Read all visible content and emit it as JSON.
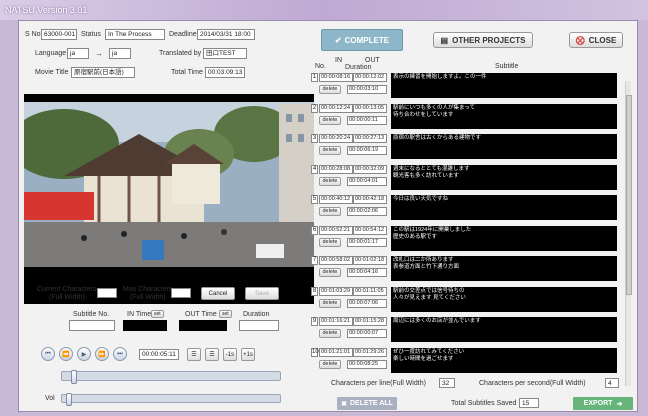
{
  "app": {
    "title": "NATSU Version 3.01"
  },
  "header": {
    "sno_label": "S No.",
    "sno_value": "63000-001",
    "status_label": "Status",
    "status_value": "In The Process",
    "deadline_label": "Deadline",
    "deadline_value": "2014/03/31 18:00",
    "language_label": "Language",
    "lang_from": "ja",
    "lang_to": "ja",
    "arrow": "→",
    "translated_label": "Translated by",
    "translated_value": "田口TEST",
    "movie_title_label": "Movie Title",
    "movie_title_value": "原宿駅前(日本語)",
    "total_time_label": "Total Time",
    "total_time_value": "00:03:09:13"
  },
  "buttons": {
    "complete": "COMPLETE",
    "other_projects": "OTHER PROJECTS",
    "close": "CLOSE",
    "cancel": "Cancel",
    "save": "Save",
    "delete_all": "DELETE ALL",
    "export": "EXPORT"
  },
  "list_header": {
    "no": "No.",
    "in": "IN",
    "out": "OUT",
    "duration": "Duration",
    "subtitle": "Subtitle"
  },
  "rows": [
    {
      "no": "1",
      "in": "00:00:08:16",
      "out": "00:00:12:02",
      "delete": "delete",
      "dur": "00:00:03:10",
      "sub": "表示の練習を開始しますよ。この一件"
    },
    {
      "no": "2",
      "in": "00:00:12:24",
      "out": "00:00:13:05",
      "delete": "delete",
      "dur": "00:00:00:11",
      "sub": "駅前にいつも多くの人が集まって\n待ち合わせをしています"
    },
    {
      "no": "3",
      "in": "00:00:20:24",
      "out": "00:00:27:13",
      "delete": "delete",
      "dur": "00:00:06:19",
      "sub": "原宿の駅舎は古くからある建物です"
    },
    {
      "no": "4",
      "in": "00:00:28:08",
      "out": "00:00:32:09",
      "delete": "delete",
      "dur": "00:00:04:01",
      "sub": "週末になるととても混雑します\n観光客も多く訪れています"
    },
    {
      "no": "5",
      "in": "00:00:40:12",
      "out": "00:00:42:18",
      "delete": "delete",
      "dur": "00:00:02:06",
      "sub": "今日は良い天気ですね"
    },
    {
      "no": "6",
      "in": "00:00:52:21",
      "out": "00:00:54:12",
      "delete": "delete",
      "dur": "00:00:01:17",
      "sub": "この駅は1924年に開業しました\n歴史のある駅です"
    },
    {
      "no": "7",
      "in": "00:00:58:02",
      "out": "00:01:02:18",
      "delete": "delete",
      "dur": "00:00:04:16",
      "sub": "改札口は二か所あります\n表参道方面と竹下通り方面"
    },
    {
      "no": "8",
      "in": "00:01:03:29",
      "out": "00:01:11:05",
      "delete": "delete",
      "dur": "00:00:07:06",
      "sub": "駅前の交差点では信号待ちの\n人々が見えます 見てください"
    },
    {
      "no": "9",
      "in": "00:01:16:21",
      "out": "00:01:15:28",
      "delete": "delete",
      "dur": "00:00:00:07",
      "sub": "周辺には多くのお店が並んでいます"
    },
    {
      "no": "10",
      "in": "00:01:21:01",
      "out": "00:01:29:26",
      "delete": "delete",
      "dur": "00:00:08:25",
      "sub": "ぜひ一度訪れてみてください\n楽しい時間を過ごせます"
    }
  ],
  "editor": {
    "current_chars_label": "Current Characters\n(Full Width)",
    "max_chars_label": "Max Characters\n(Full Width)",
    "subtitle_no_label": "Subtitle No.",
    "in_time_label": "IN Time",
    "out_time_label": "OUT Time",
    "set_label": "set",
    "duration_label": "Duration"
  },
  "player": {
    "timecode": "00:00:05:11",
    "minus_label": "-1s",
    "plus_label": "+1s",
    "vol_label": "Vol",
    "seek_fraction": 0.04,
    "vol_fraction": 0.02
  },
  "footer": {
    "cpl_label": "Characters per line(Full Width)",
    "cpl_value": "32",
    "cps_label": "Characters per second(Full Width)",
    "cps_value": "4",
    "total_label": "Total Subtitles Saved",
    "total_value": "15"
  }
}
